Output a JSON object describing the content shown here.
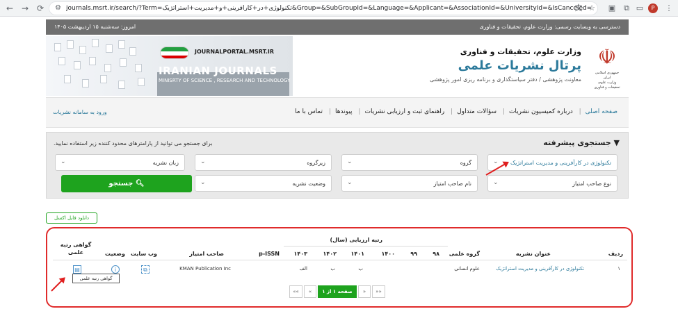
{
  "browser": {
    "url": "journals.msrt.ir/search/?Term=تکنولوژی+در+کارآفرینی+و+مدیریت+استراتژیک&Group=&SubGroupId=&Language=&Applicant=&AssociationId=&UniversityId=&IsCanceled=",
    "profile_initial": "P"
  },
  "topbar": {
    "access_text": "دسترسی به وبسایت رسمی: وزارت علوم، تحقیقات و فناوری",
    "date_text": "امروز: سه‌شنبه ۱۵ اردیبهشت ۱۴۰۵"
  },
  "header": {
    "site_url": "JOURNALPORTAL.MSRT.IR",
    "journals_title": "IRANIAN JOURNALS",
    "journals_subtitle": "MINISRTY OF SCIENCE , RESEARCH AND TECHNOLOGY",
    "ministry": "وزارت علوم، تحقیقات و فناوری",
    "portal": "پرتال نشریات علمی",
    "deputy": "معاونت پژوهشی / دفتر سیاستگذاری و برنامه ریزی امور پژوهشی",
    "emblem_caption_1": "جمهوری اسلامی ایران",
    "emblem_caption_2": "وزارت علوم، تحقیقات و فناوری"
  },
  "nav": {
    "items": [
      "صفحه اصلی",
      "درباره کمیسیون نشریات",
      "سؤالات متداول",
      "راهنمای ثبت و ارزیابی نشریات",
      "پیوندها",
      "تماس با ما"
    ],
    "login": "ورود به سامانه نشریات"
  },
  "search": {
    "title": "جستجوی پیشرفته",
    "description": "برای جستجو می توانید از پارامترهای محدود کننده زیر استفاده نمایید.",
    "term_value": "تکنولوژی در کارآفرینی و مدیریت استراتژیک",
    "group": "گروه",
    "subgroup": "زیرگروه",
    "language": "زبان نشریه",
    "applicant_type": "نوع صاحب امتیاز",
    "applicant_name": "نام صاحب امتیاز",
    "status": "وضعیت نشریه",
    "button": "جستجو"
  },
  "download_label": "دانلود فایل اکسل",
  "table": {
    "headers": {
      "row": "ردیف",
      "title": "عنوان نشریه",
      "group": "گروه علمی",
      "rank": "رتبه ارزیابی (سال)",
      "years": [
        "۹۸",
        "۹۹",
        "۱۴۰۰",
        "۱۴۰۱",
        "۱۴۰۲",
        "۱۴۰۳"
      ],
      "pissn": "p-ISSN",
      "applicant": "صاحب امتیاز",
      "website": "وب سایت",
      "status": "وضعیت",
      "certificate": "گواهی رتبه علمی"
    },
    "rows": [
      {
        "num": "۱",
        "title": "تکنولوژی در کارآفرینی و مدیریت استراتژیک",
        "group": "علوم انسانی",
        "r1401": "ب",
        "r1402": "ب",
        "r1403": "الف",
        "applicant": "KMAN Publication Inc"
      }
    ],
    "tooltip": "گواهی رتبه علمی"
  },
  "pagination": {
    "current": "صفحه ۱ از ۱",
    "first": "««",
    "prev": "«",
    "next": "»",
    "last": "»»"
  },
  "colors": {
    "accent": "#2c7a9b",
    "green": "#1ea31e",
    "highlight_red": "#e02b2b"
  }
}
